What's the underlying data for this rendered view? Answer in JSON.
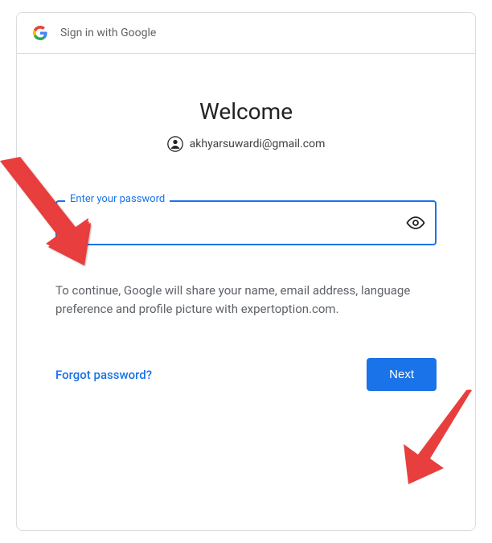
{
  "header": {
    "title": "Sign in with Google"
  },
  "main": {
    "title": "Welcome",
    "email": "akhyarsuwardi@gmail.com",
    "password_label": "Enter your password",
    "password_value": "",
    "disclosure": "To continue, Google will share your name, email address, language preference and profile picture with expertoption.com."
  },
  "footer": {
    "forgot_label": "Forgot password?",
    "next_label": "Next"
  }
}
